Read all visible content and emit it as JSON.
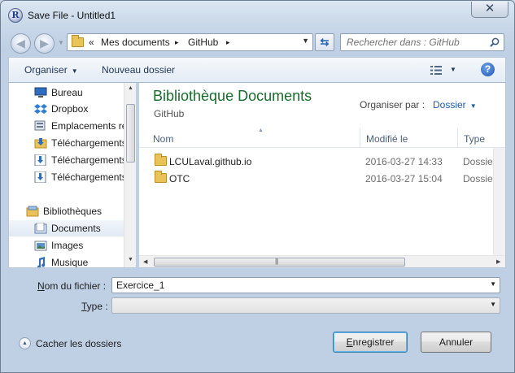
{
  "window": {
    "title": "Save File - Untitled1",
    "app_icon_letter": "R",
    "close_symbol": "✕"
  },
  "address": {
    "chevrons": "«",
    "crumbs": [
      "Mes documents",
      "GitHub"
    ],
    "separator": "▸",
    "search_placeholder": "Rechercher dans : GitHub"
  },
  "toolbar": {
    "organiser_label": "Organiser",
    "new_folder_label": "Nouveau dossier",
    "help_symbol": "?"
  },
  "navpane": {
    "items": [
      {
        "label": "Bureau",
        "icon": "desktop-icon"
      },
      {
        "label": "Dropbox",
        "icon": "dropbox-icon"
      },
      {
        "label": "Emplacements récents",
        "icon": "recent-places-icon"
      },
      {
        "label": "Téléchargements",
        "icon": "folder-download-icon"
      },
      {
        "label": "Téléchargements",
        "icon": "download-icon"
      },
      {
        "label": "Téléchargements",
        "icon": "download-icon"
      }
    ],
    "libraries_label": "Bibliothèques",
    "library_items": [
      {
        "label": "Documents",
        "icon": "documents-icon",
        "selected": true
      },
      {
        "label": "Images",
        "icon": "images-icon"
      },
      {
        "label": "Musique",
        "icon": "music-icon"
      }
    ]
  },
  "filepane": {
    "library_title": "Bibliothèque Documents",
    "library_subtitle": "GitHub",
    "arrange_label": "Organiser par :",
    "arrange_value": "Dossier",
    "columns": {
      "name": "Nom",
      "modified": "Modifié le",
      "type": "Type"
    },
    "rows": [
      {
        "name": "LCULaval.github.io",
        "modified": "2016-03-27 14:33",
        "type": "Dossier de fichiers"
      },
      {
        "name": "OTC",
        "modified": "2016-03-27 15:04",
        "type": "Dossier de fichiers"
      }
    ]
  },
  "form": {
    "filename_label_prefix": "N",
    "filename_label_rest": "om du fichier :",
    "filename_value": "Exercice_1",
    "type_label_prefix": "T",
    "type_label_rest": "ype :",
    "type_value": ""
  },
  "footer": {
    "hide_folders_label": "Cacher les dossiers",
    "save_prefix": "E",
    "save_rest": "nregistrer",
    "cancel_label": "Annuler"
  },
  "colors": {
    "library_title": "#1a6b2d",
    "link_blue": "#1d5aa8",
    "folder": "#e9c35a"
  }
}
